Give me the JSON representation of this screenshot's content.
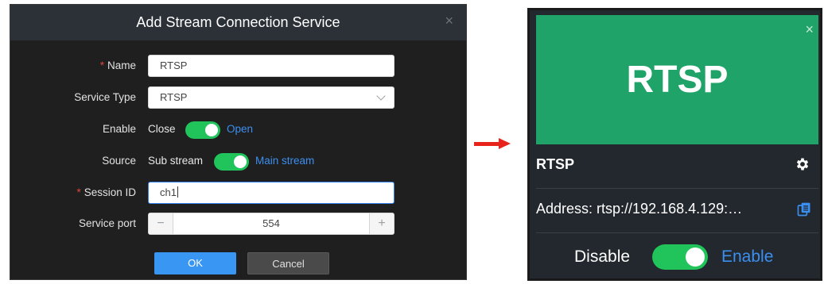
{
  "dialog": {
    "title": "Add Stream Connection Service",
    "close_icon": "×",
    "required_mark": "*",
    "name": {
      "label": "Name",
      "value": "RTSP"
    },
    "service_type": {
      "label": "Service Type",
      "value": "RTSP"
    },
    "enable": {
      "label": "Enable",
      "off_text": "Close",
      "on_text": "Open",
      "state": "on"
    },
    "source": {
      "label": "Source",
      "off_text": "Sub stream",
      "on_text": "Main stream",
      "state": "on"
    },
    "session_id": {
      "label": "Session ID",
      "value": "ch1"
    },
    "service_port": {
      "label": "Service port",
      "value": "554",
      "minus": "−",
      "plus": "+"
    },
    "ok_label": "OK",
    "cancel_label": "Cancel"
  },
  "card": {
    "banner_title": "RTSP",
    "close_icon": "×",
    "name": "RTSP",
    "address": "Address:  rtsp://192.168.4.129:…",
    "footer": {
      "disable_text": "Disable",
      "enable_text": "Enable",
      "state": "on"
    }
  },
  "colors": {
    "accent_blue": "#3b8ff0",
    "toggle_green": "#21c35b",
    "banner_green": "#1fa368",
    "arrow_red": "#e8231b",
    "required_red": "#e0453b"
  },
  "icons": {
    "dialog_close": "close-icon",
    "select_chevron": "chevron-down-icon",
    "arrow": "arrow-right-icon",
    "card_close": "close-icon",
    "settings": "gear-icon",
    "copy": "copy-icon"
  }
}
